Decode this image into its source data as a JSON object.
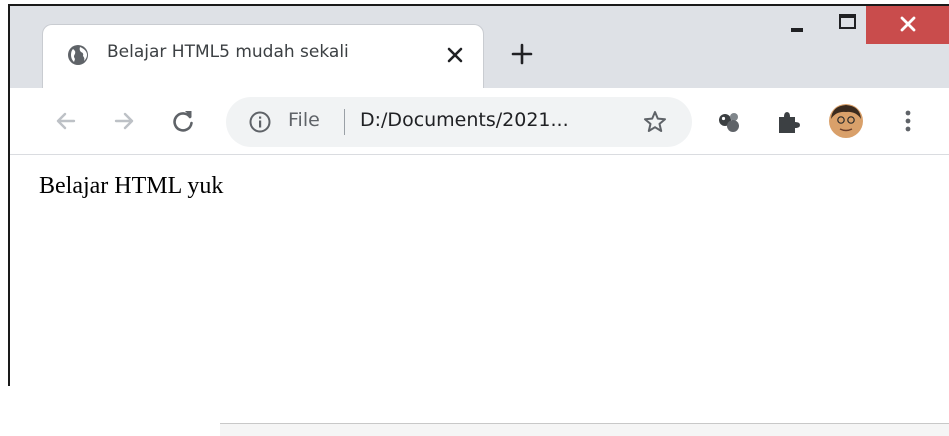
{
  "tab": {
    "title": "Belajar HTML5 mudah sekali",
    "favicon": "globe-icon"
  },
  "window_controls": [
    "minimize-icon",
    "maximize-icon",
    "close-icon"
  ],
  "toolbar": {
    "back": "arrow-left-icon",
    "forward": "arrow-right-icon",
    "reload": "reload-icon",
    "extensions": [
      "extension-spheres-icon",
      "puzzle-icon"
    ],
    "profile": "avatar",
    "menu": "kebab-menu-icon"
  },
  "omnibox": {
    "chip_label": "File",
    "url": "D:/Documents/2021..."
  },
  "page": {
    "text": "Belajar HTML yuk"
  },
  "colors": {
    "tabstrip": "#dee1e6",
    "close_button": "#c94c4c",
    "omnibox": "#f1f3f4"
  }
}
